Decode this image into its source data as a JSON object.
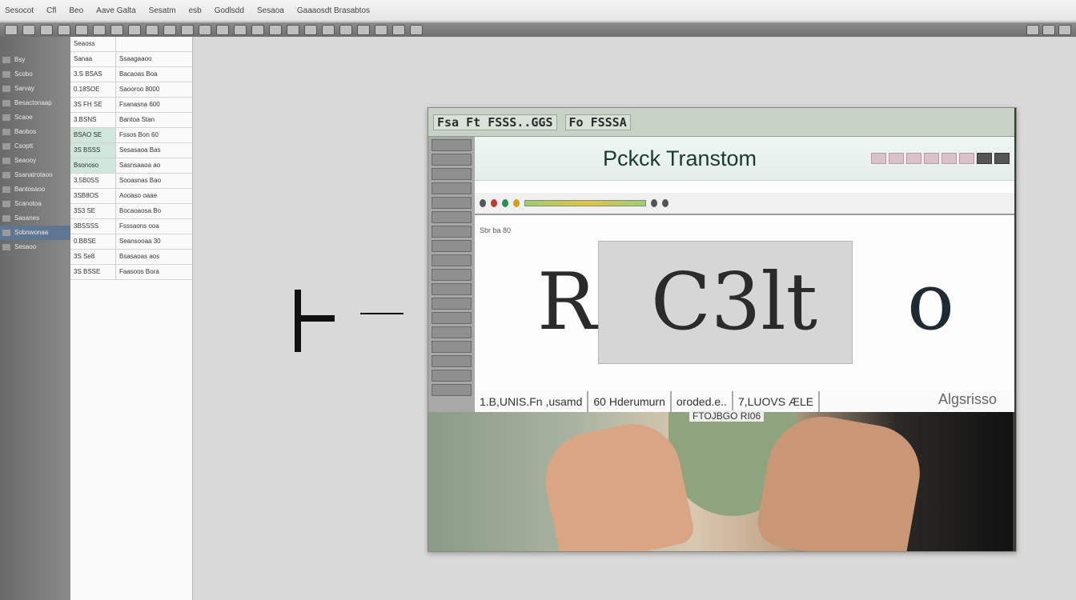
{
  "menubar": {
    "items": [
      "Sesocot",
      "Cfl",
      "Beo",
      "Aave Galta",
      "Sesatm",
      "esb",
      "Godlsdd",
      "Sesaoa",
      "Gaaaosdt Brasabtos"
    ]
  },
  "left_sidebar": {
    "items": [
      "Bsy",
      "Scobo",
      "Sarvay",
      "Besactonaap",
      "Scaoe",
      "Baobos",
      "Csoptt",
      "Seaooy",
      "Ssanatrotaoo",
      "Bantosaoo",
      "Scanotoa",
      "Sasanes",
      "Sobnwonaa",
      "Sesaoo"
    ]
  },
  "list_panel": {
    "header": "Seaoss",
    "rows": [
      {
        "c1": "Sanaa",
        "c2": "Ssaagaaoo"
      },
      {
        "c1": "3.S BSAS",
        "c2": "Bacaoas Boa"
      },
      {
        "c1": "0.18SOE",
        "c2": "Saooroo 8000"
      },
      {
        "c1": "3S FH SE",
        "c2": "Fsanasna 600"
      },
      {
        "c1": "3.BSNS",
        "c2": "Bantoa Stan"
      },
      {
        "c1": "BSAO SE",
        "c2": "Fssos Bon 60"
      },
      {
        "c1": "3S BSSS",
        "c2": "Sesasaoa Bas"
      },
      {
        "c1": "Bsonoso",
        "c2": "Sasnsaaoa ao"
      },
      {
        "c1": "3.5B0SS",
        "c2": "Sooasnas Bao"
      },
      {
        "c1": "3SB8OS",
        "c2": "Aooaso oaae"
      },
      {
        "c1": "3S3 SE",
        "c2": "Bocaoaosa Bo"
      },
      {
        "c1": "3BSSSS",
        "c2": "Fsssaons ooa"
      },
      {
        "c1": "0.BBSE",
        "c2": "Seansooaa 30"
      },
      {
        "c1": "3S Se8",
        "c2": "Bsasaoas aos"
      },
      {
        "c1": "3S BSSE",
        "c2": "Faasoos Bora"
      }
    ]
  },
  "preview": {
    "title_bar": [
      "Fsa Ft FSSS..GGS",
      "Fo FSSSA"
    ],
    "ribbon_title": "Pckck Transtom",
    "small_label": "Sbr ba 80",
    "letters": [
      "R",
      "C3lt",
      "o"
    ],
    "bottom_segments": [
      "1.B,UNIS.Fn ,usamd",
      "60 Hderumurn",
      "oroded.e..",
      "7,LUOVS ÆLE"
    ],
    "caption2": "FTOJBGO RI06",
    "right_label": "Algsrisso"
  }
}
